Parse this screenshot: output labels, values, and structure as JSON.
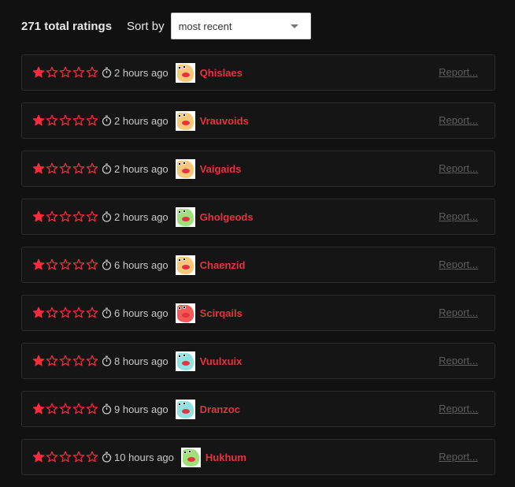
{
  "header": {
    "total_label": "271 total ratings",
    "sort_label": "Sort by",
    "sort_value": "most recent"
  },
  "colors": {
    "accent": "#e8323f",
    "star_filled": "#ff2a3d",
    "muted": "#5e5e5e"
  },
  "reviews": [
    {
      "rating": 1,
      "max_rating": 5,
      "time": "2 hours ago",
      "user": "Qhislaes",
      "avatar_color": "#f7c87a",
      "report": "Report..."
    },
    {
      "rating": 1,
      "max_rating": 5,
      "time": "2 hours ago",
      "user": "Vrauvoids",
      "avatar_color": "#f7c87a",
      "report": "Report..."
    },
    {
      "rating": 1,
      "max_rating": 5,
      "time": "2 hours ago",
      "user": "Vaigaids",
      "avatar_color": "#f7c87a",
      "report": "Report..."
    },
    {
      "rating": 1,
      "max_rating": 5,
      "time": "2 hours ago",
      "user": "Gholgeods",
      "avatar_color": "#9ee07a",
      "report": "Report..."
    },
    {
      "rating": 1,
      "max_rating": 5,
      "time": "6 hours ago",
      "user": "Chaenzid",
      "avatar_color": "#f7c87a",
      "report": "Report..."
    },
    {
      "rating": 1,
      "max_rating": 5,
      "time": "6 hours ago",
      "user": "Scirqails",
      "avatar_color": "#f25a5a",
      "report": "Report..."
    },
    {
      "rating": 1,
      "max_rating": 5,
      "time": "8 hours ago",
      "user": "Vuulxuix",
      "avatar_color": "#8fe3e0",
      "report": "Report..."
    },
    {
      "rating": 1,
      "max_rating": 5,
      "time": "9 hours ago",
      "user": "Dranzoc",
      "avatar_color": "#8fe3e0",
      "report": "Report..."
    },
    {
      "rating": 1,
      "max_rating": 5,
      "time": "10 hours ago",
      "user": "Hukhum",
      "avatar_color": "#9ee07a",
      "report": "Report..."
    }
  ]
}
